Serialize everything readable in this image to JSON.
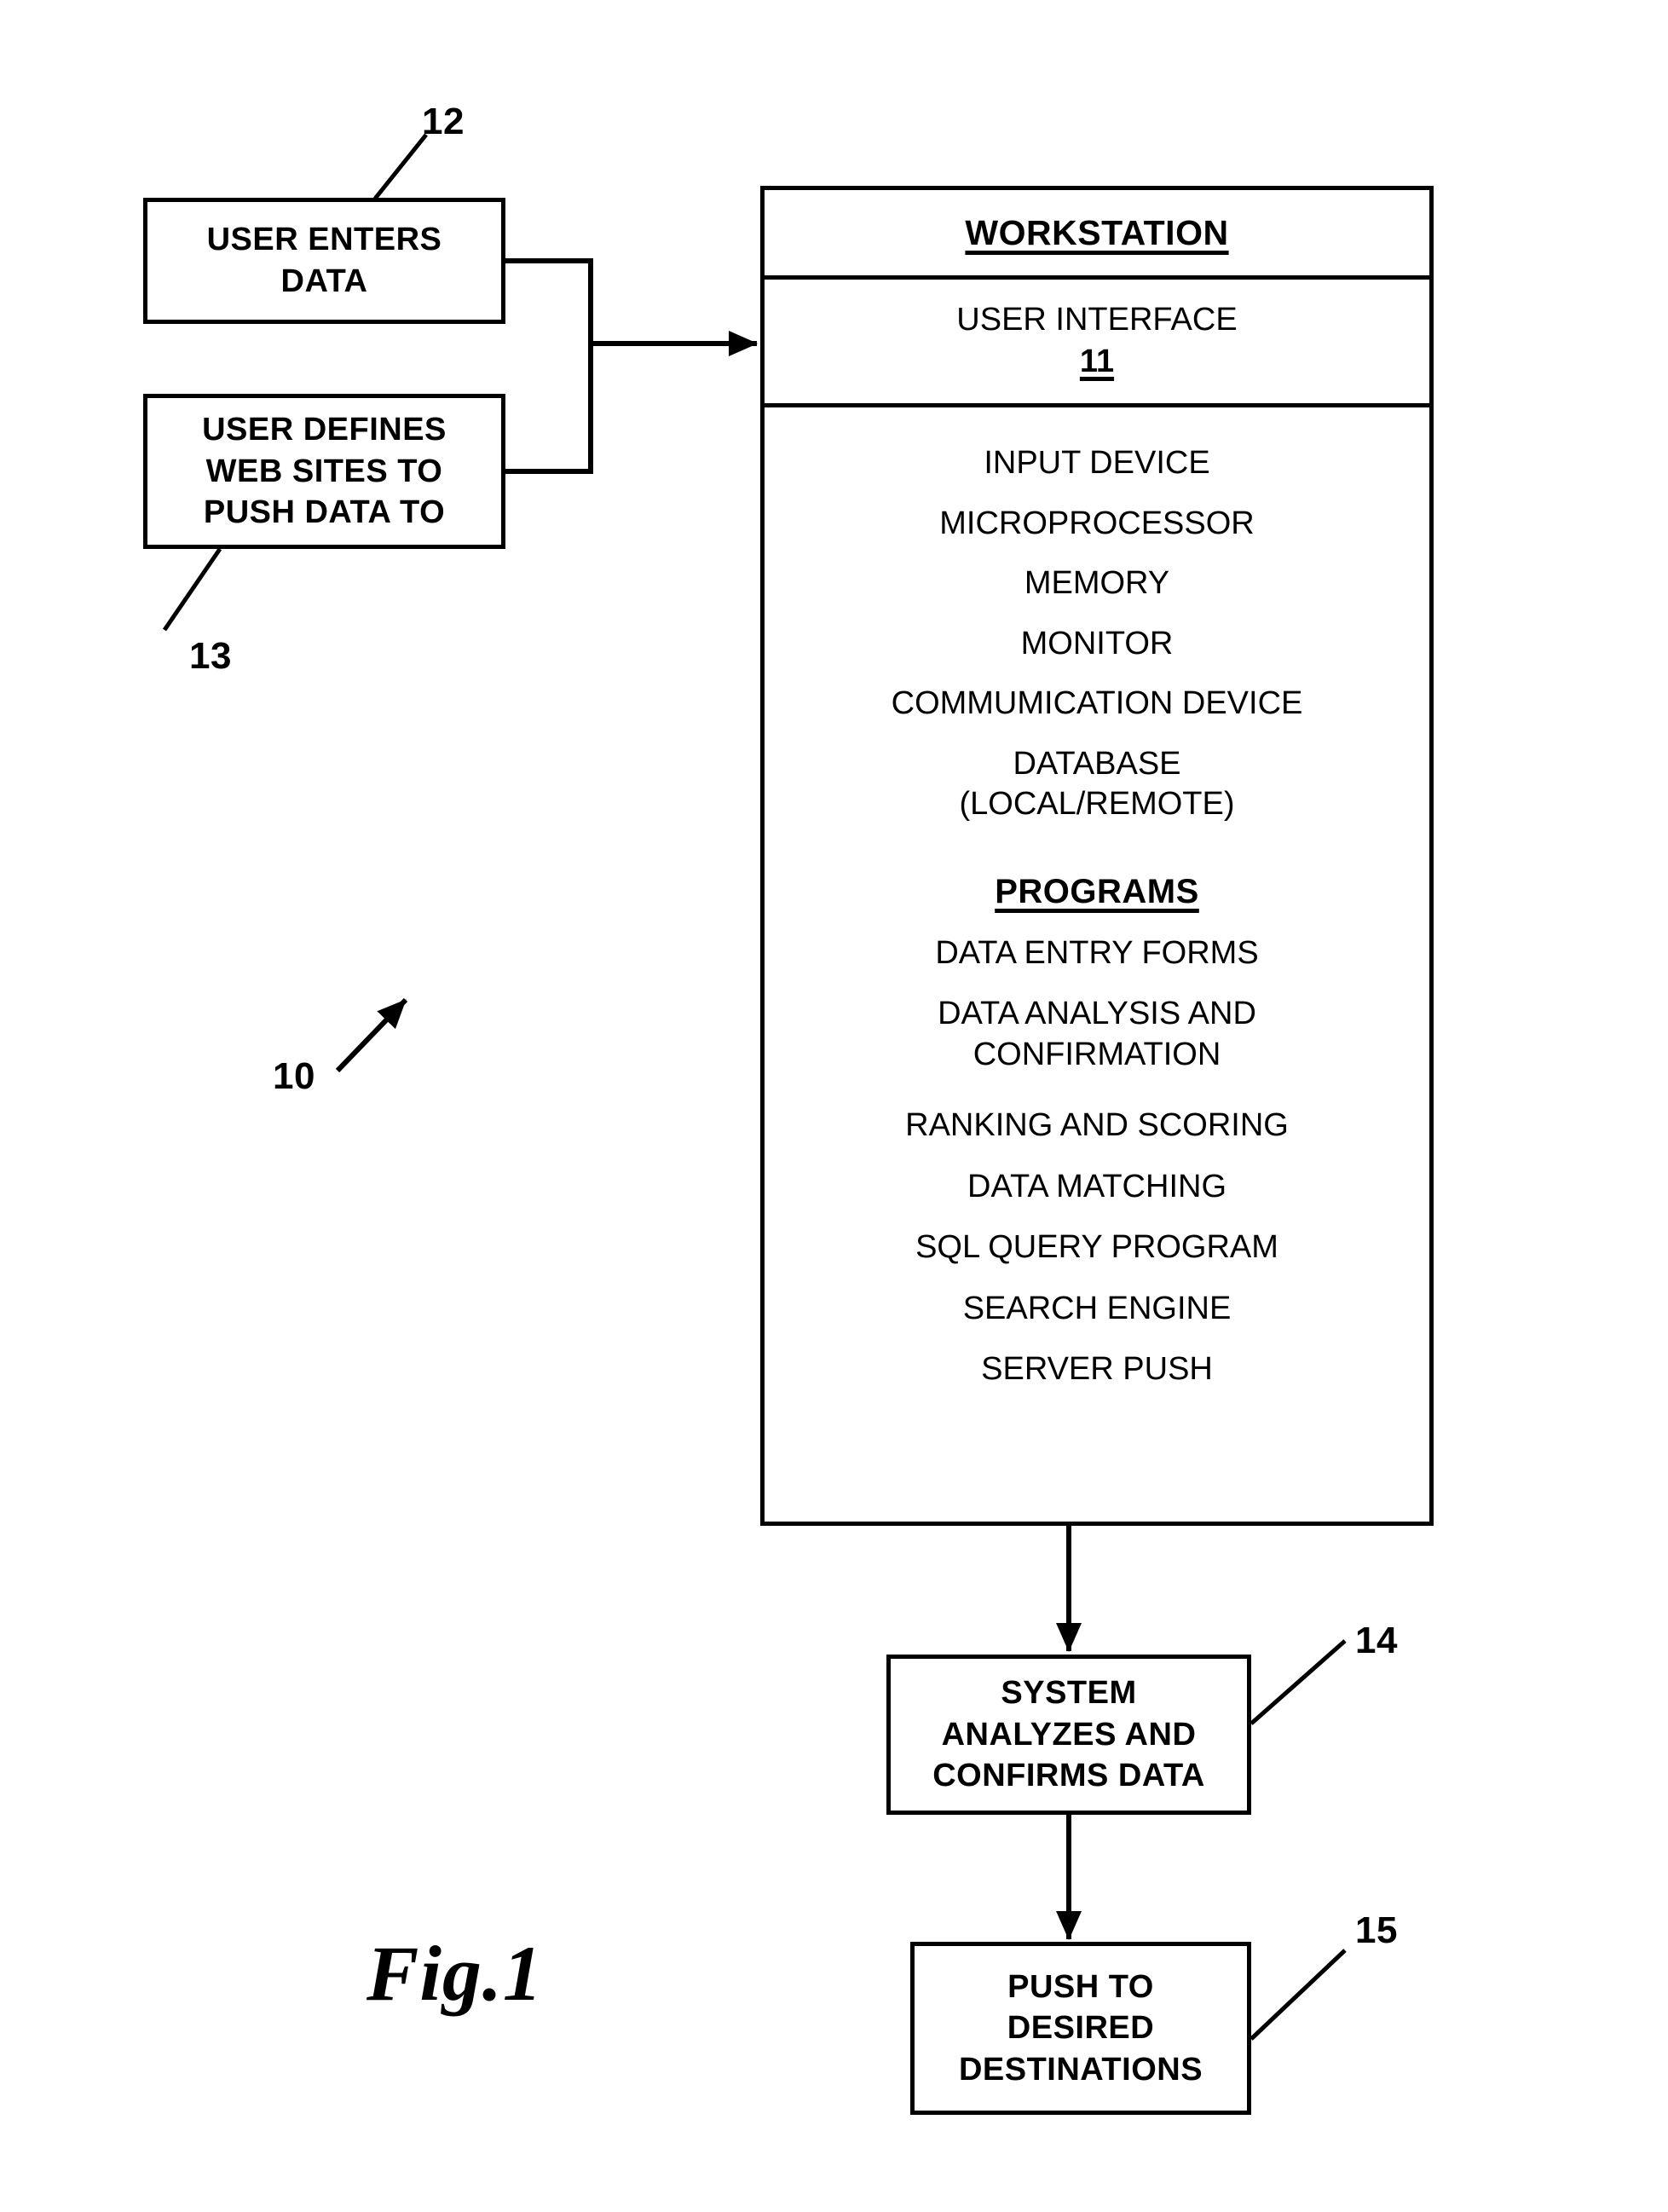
{
  "figure": {
    "caption": "Fig.1",
    "system_ref": "10"
  },
  "left_flow": {
    "user_enters_data": {
      "ref": "12",
      "lines": [
        "USER ENTERS",
        "DATA"
      ]
    },
    "user_defines_sites": {
      "ref": "13",
      "lines": [
        "USER DEFINES",
        "WEB SITES TO",
        "PUSH DATA TO"
      ]
    }
  },
  "workstation": {
    "title": "WORKSTATION",
    "user_interface": {
      "label": "USER INTERFACE",
      "ref": "11"
    },
    "components": [
      {
        "lines": [
          "INPUT DEVICE"
        ]
      },
      {
        "lines": [
          "MICROPROCESSOR"
        ]
      },
      {
        "lines": [
          "MEMORY"
        ]
      },
      {
        "lines": [
          "MONITOR"
        ]
      },
      {
        "lines": [
          "COMMUMICATION DEVICE"
        ]
      },
      {
        "lines": [
          "DATABASE",
          "(LOCAL/REMOTE)"
        ]
      }
    ],
    "programs_heading": "PROGRAMS",
    "programs": [
      {
        "lines": [
          "DATA ENTRY FORMS"
        ]
      },
      {
        "lines": [
          "DATA ANALYSIS AND",
          "CONFIRMATION"
        ]
      },
      {
        "lines": [
          "RANKING AND SCORING"
        ]
      },
      {
        "lines": [
          "DATA MATCHING"
        ]
      },
      {
        "lines": [
          "SQL QUERY PROGRAM"
        ]
      },
      {
        "lines": [
          "SEARCH ENGINE"
        ]
      },
      {
        "lines": [
          "SERVER PUSH"
        ]
      }
    ]
  },
  "bottom_flow": {
    "system_analyzes": {
      "ref": "14",
      "lines": [
        "SYSTEM",
        "ANALYZES AND",
        "CONFIRMS DATA"
      ]
    },
    "push_destinations": {
      "ref": "15",
      "lines": [
        "PUSH TO",
        "DESIRED",
        "DESTINATIONS"
      ]
    }
  },
  "colors": {
    "ink": "#000000",
    "paper": "#ffffff"
  }
}
